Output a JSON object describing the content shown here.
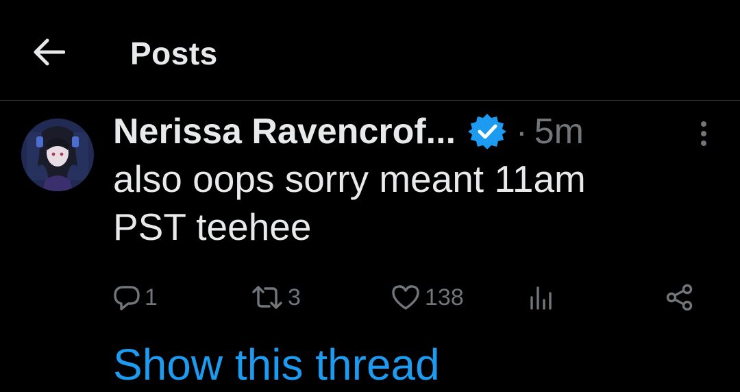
{
  "header": {
    "back_icon": "arrow-left-icon",
    "title": "Posts"
  },
  "post": {
    "author_name": "Nerissa Ravencrof...",
    "verified_icon": "verified-badge-icon",
    "separator": "·",
    "time": "5m",
    "more_icon": "more-vertical-icon",
    "text": "also oops sorry meant 11am\nPST teehee",
    "actions": {
      "reply": {
        "icon": "reply-icon",
        "count": "1"
      },
      "repost": {
        "icon": "repost-icon",
        "count": "3"
      },
      "like": {
        "icon": "heart-icon",
        "count": "138"
      },
      "views": {
        "icon": "views-chart-icon"
      },
      "share": {
        "icon": "share-icon"
      }
    },
    "show_thread_label": "Show this thread"
  },
  "colors": {
    "background": "#000000",
    "text_primary": "#e7e9ea",
    "text_secondary": "#71767b",
    "accent": "#1d9bf0",
    "divider": "#2f3336"
  }
}
